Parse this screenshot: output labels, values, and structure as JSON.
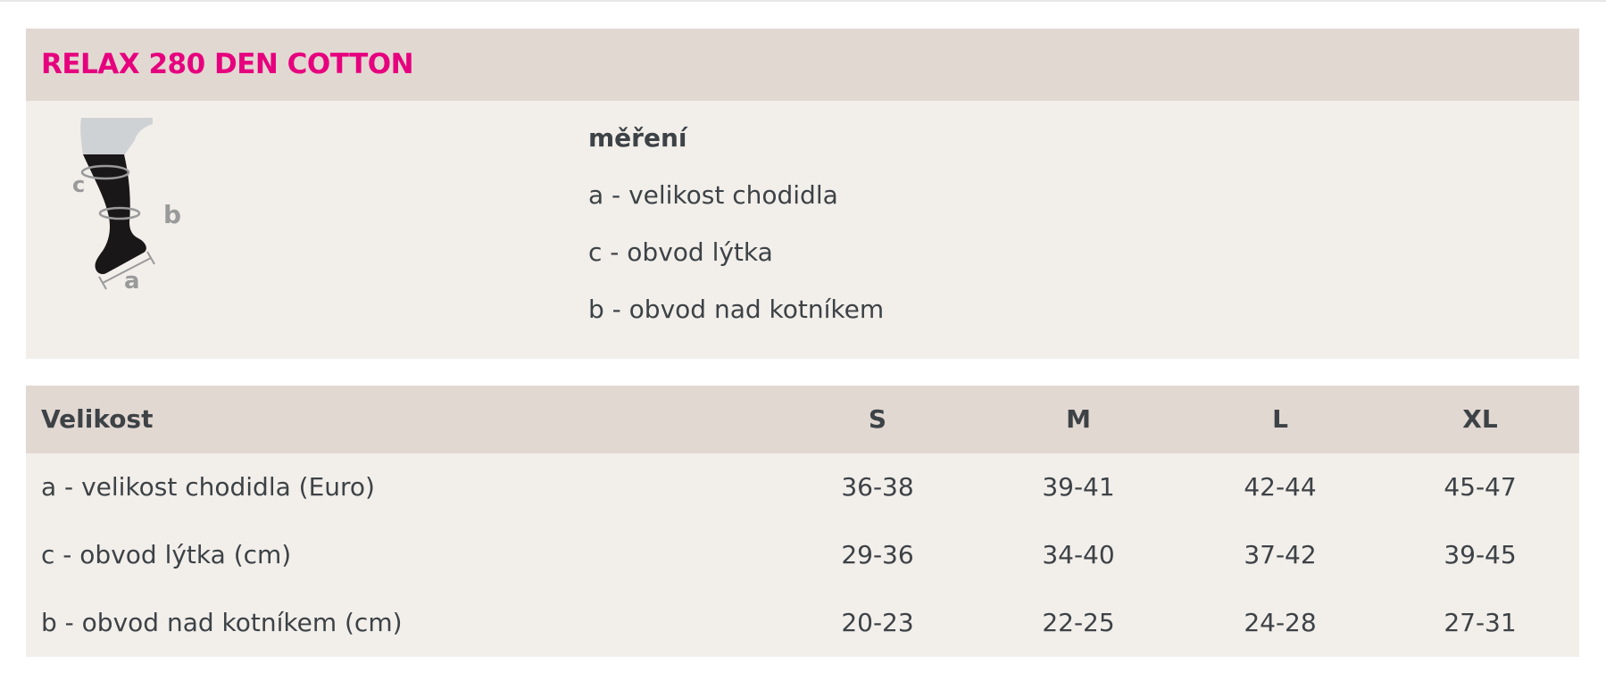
{
  "title": "RELAX 280 DEN COTTON",
  "measurement": {
    "heading": "měření",
    "items": [
      "a - velikost chodidla",
      "c - obvod lýtka",
      "b - obvod nad kotníkem"
    ],
    "diagram_labels": {
      "a": "a",
      "b": "b",
      "c": "c"
    }
  },
  "table": {
    "headers": [
      "Velikost",
      "S",
      "M",
      "L",
      "XL"
    ],
    "rows": [
      {
        "label": "a - velikost chodidla (Euro)",
        "values": [
          "36-38",
          "39-41",
          "42-44",
          "45-47"
        ]
      },
      {
        "label": "c - obvod lýtka (cm)",
        "values": [
          "29-36",
          "34-40",
          "37-42",
          "39-45"
        ]
      },
      {
        "label": "b - obvod nad kotníkem (cm)",
        "values": [
          "20-23",
          "22-25",
          "24-28",
          "27-31"
        ]
      }
    ]
  },
  "colors": {
    "accent": "#e6007e",
    "header_bg": "#e2d8d2",
    "body_bg": "#f2efeb",
    "text": "#3d4246"
  }
}
